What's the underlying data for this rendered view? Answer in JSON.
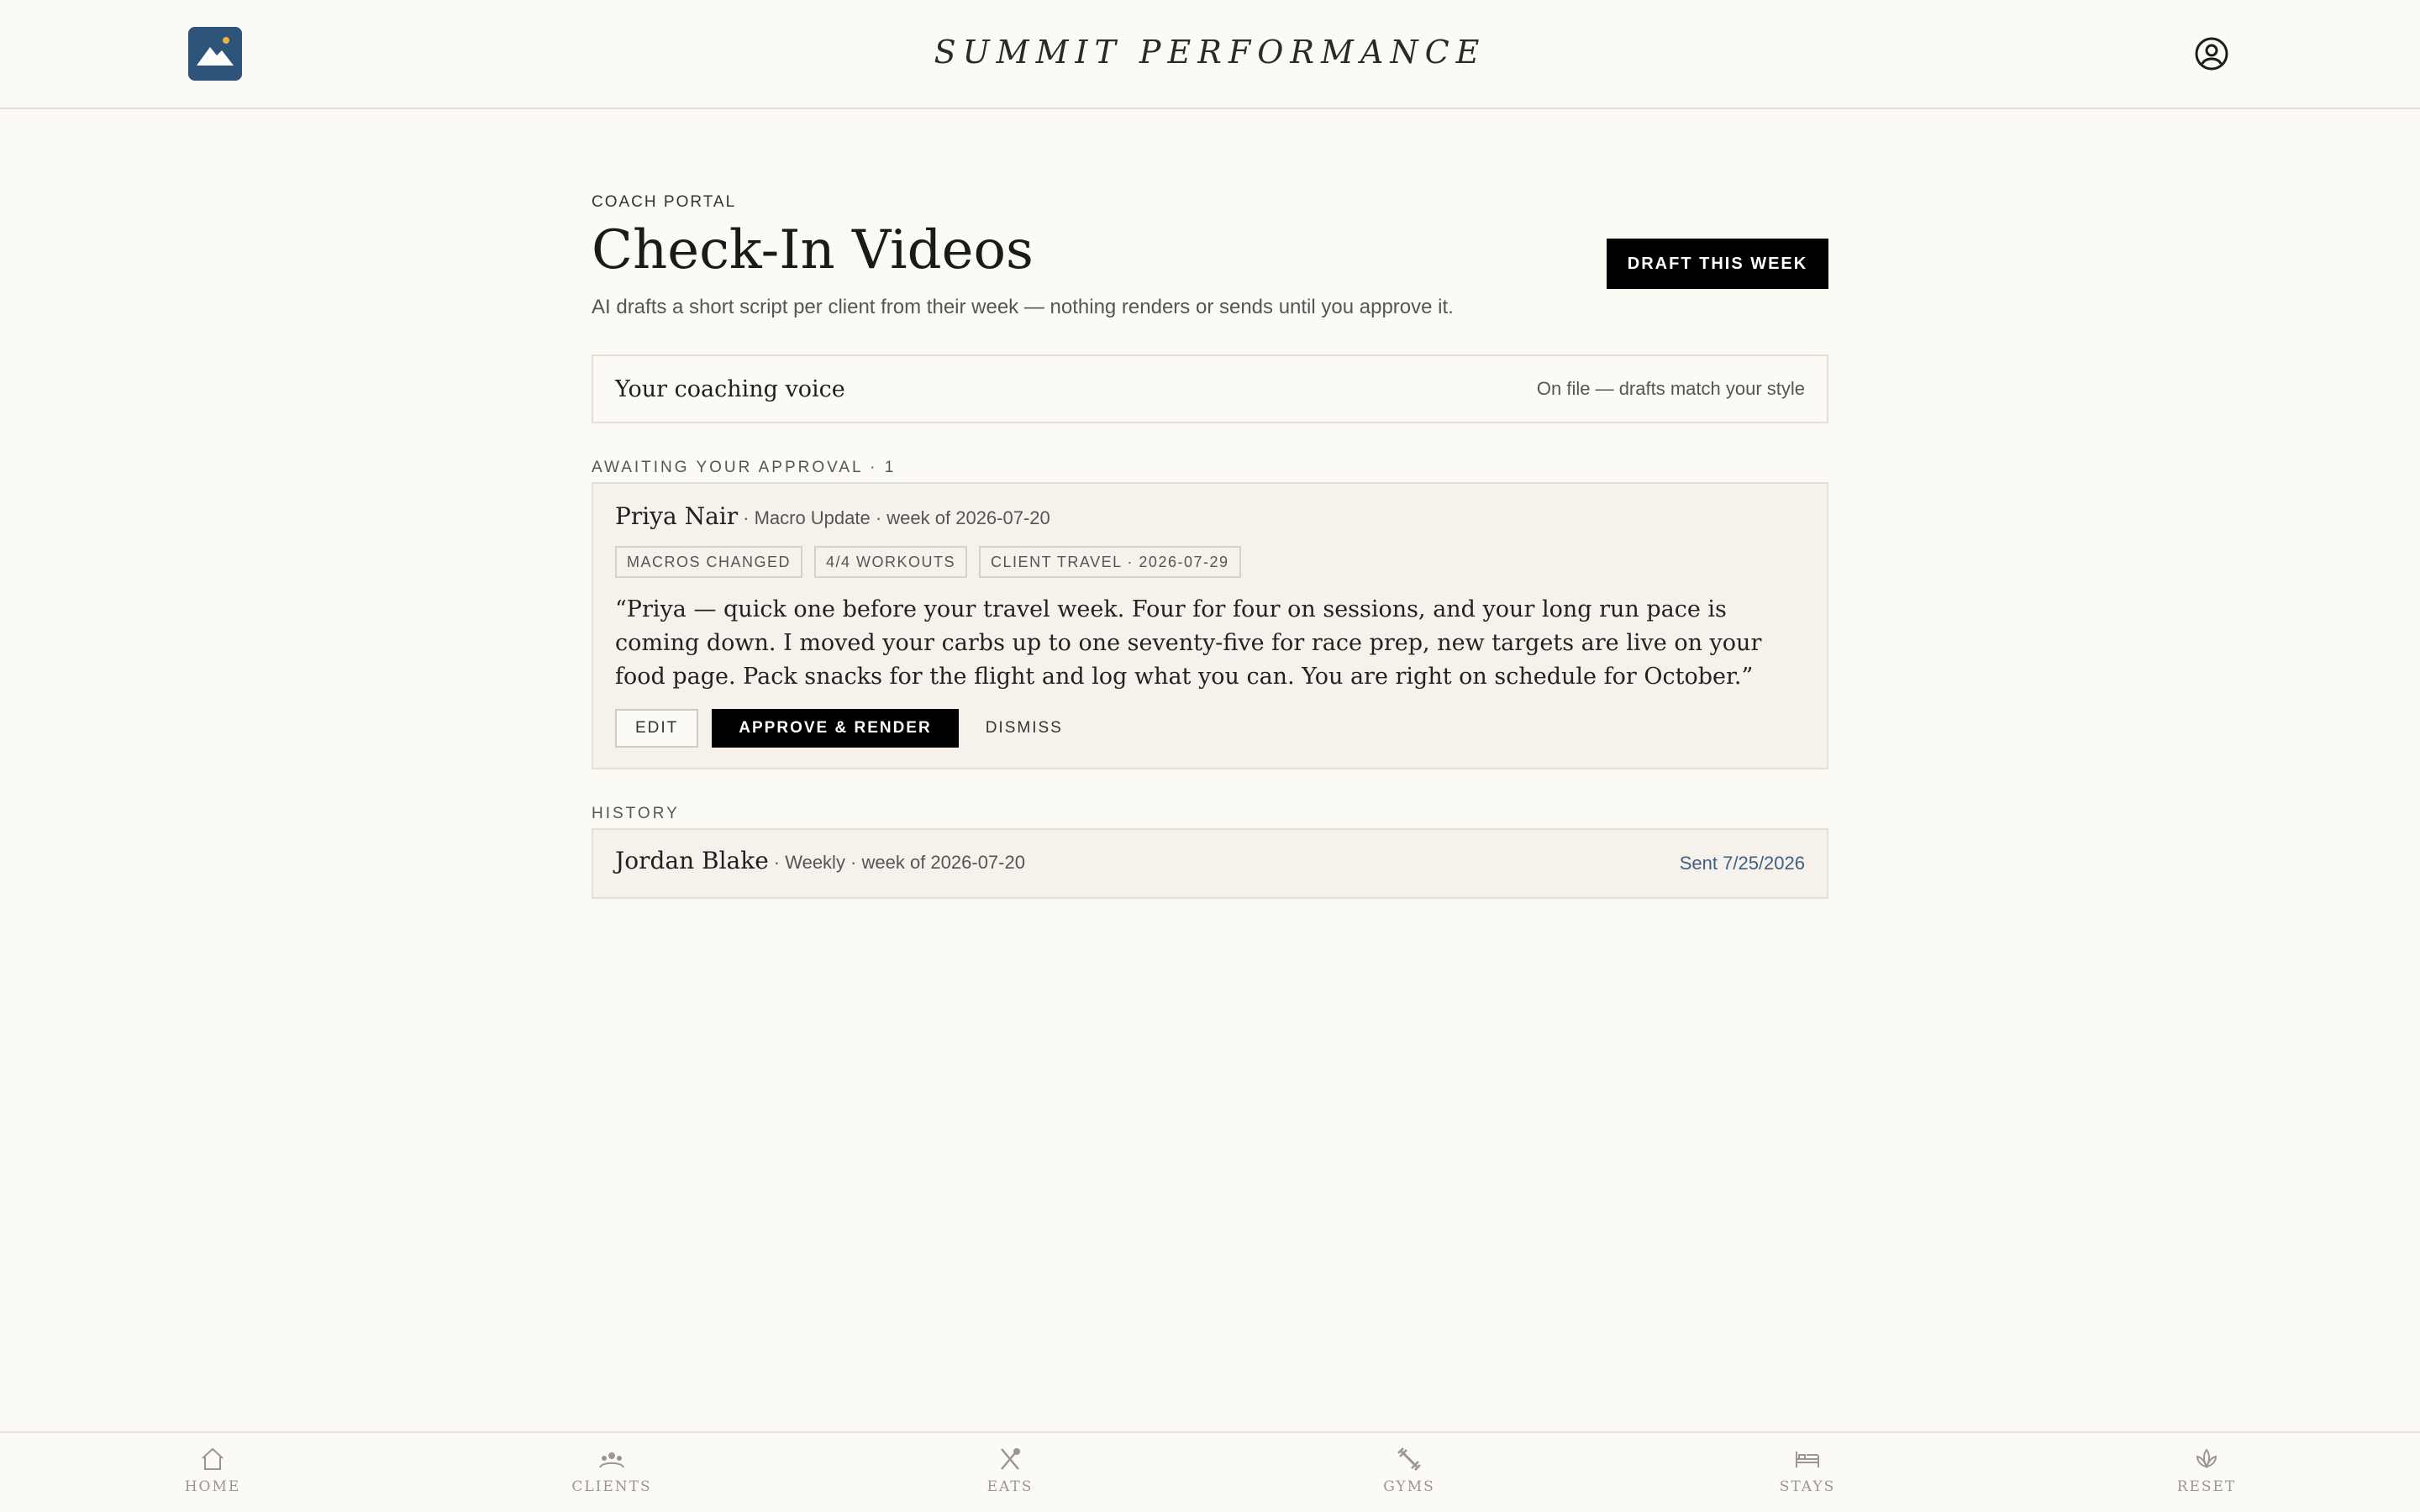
{
  "header": {
    "brand": "SUMMIT PERFORMANCE",
    "logo_icon": "mountain-sun-icon",
    "account_icon": "user-circle-icon",
    "brand_color": "#2f5479"
  },
  "page": {
    "eyebrow": "COACH PORTAL",
    "title": "Check-In Videos",
    "subtitle": "AI drafts a short script per client from their week — nothing renders or sends until you approve it.",
    "draft_button": "DRAFT THIS WEEK"
  },
  "voice": {
    "label": "Your coaching voice",
    "status": "On file — drafts match your style"
  },
  "awaiting": {
    "label": "AWAITING YOUR APPROVAL · 1",
    "items": [
      {
        "client": "Priya Nair",
        "meta": "· Macro Update · week of 2026-07-20",
        "tags": [
          "MACROS CHANGED",
          "4/4 WORKOUTS",
          "CLIENT TRAVEL · 2026-07-29"
        ],
        "script": "“Priya — quick one before your travel week. Four for four on sessions, and your long run pace is coming down. I moved your carbs up to one seventy-five for race prep, new targets are live on your food page. Pack snacks for the flight and log what you can. You are right on schedule for October.”",
        "actions": {
          "edit": "EDIT",
          "approve": "APPROVE & RENDER",
          "dismiss": "DISMISS"
        }
      }
    ]
  },
  "history": {
    "label": "HISTORY",
    "items": [
      {
        "client": "Jordan Blake",
        "meta": "· Weekly · week of 2026-07-20",
        "status": "Sent 7/25/2026",
        "status_color": "#3e5f85"
      }
    ]
  },
  "nav": {
    "items": [
      {
        "label": "HOME",
        "icon": "home-icon"
      },
      {
        "label": "CLIENTS",
        "icon": "people-icon"
      },
      {
        "label": "EATS",
        "icon": "utensils-icon"
      },
      {
        "label": "GYMS",
        "icon": "dumbbell-icon"
      },
      {
        "label": "STAYS",
        "icon": "bed-icon"
      },
      {
        "label": "RESET",
        "icon": "lotus-icon"
      }
    ]
  }
}
